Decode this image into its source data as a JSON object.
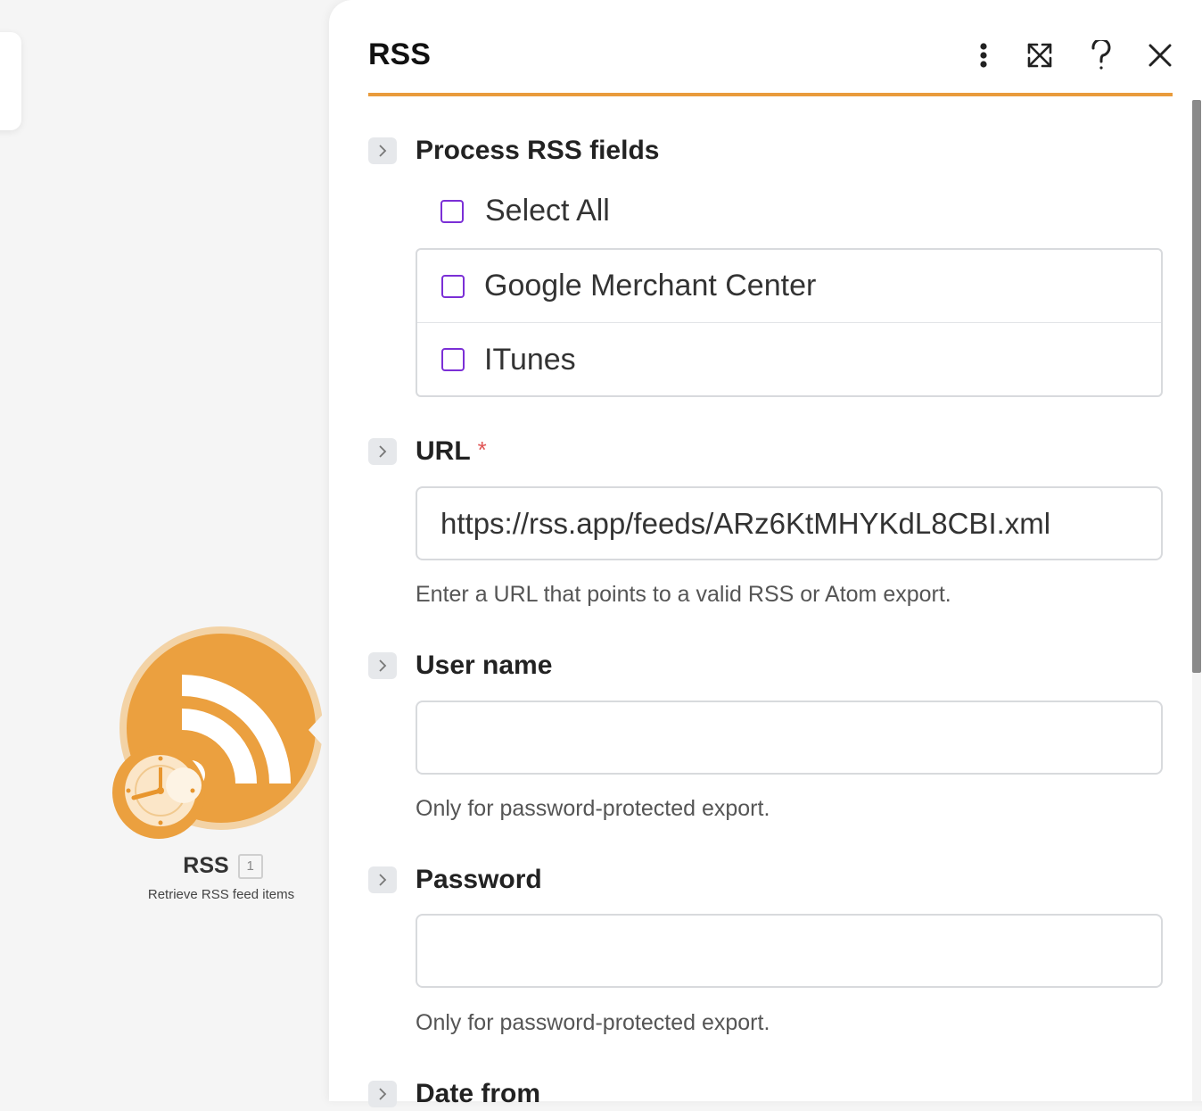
{
  "canvas": {
    "module": {
      "name": "RSS",
      "count": "1",
      "subtitle": "Retrieve RSS feed items",
      "color": "#eba03f",
      "icon": "rss-icon",
      "badge_icon": "clock-icon"
    }
  },
  "panel": {
    "title": "RSS",
    "accent_color": "#e99b3c",
    "header_buttons": [
      {
        "name": "more-options",
        "icon": "kebab-menu-icon"
      },
      {
        "name": "maximize",
        "icon": "expand-arrows-icon"
      },
      {
        "name": "help",
        "icon": "question-mark-icon"
      },
      {
        "name": "close",
        "icon": "close-icon"
      }
    ],
    "process_fields": {
      "label": "Process RSS fields",
      "select_all": "Select All",
      "options": [
        "Google Merchant Center",
        "ITunes"
      ]
    },
    "url": {
      "label": "URL",
      "required_mark": "*",
      "value": "https://rss.app/feeds/ARz6KtMHYKdL8CBI.xml",
      "hint": "Enter a URL that points to a valid RSS or Atom export."
    },
    "username": {
      "label": "User name",
      "value": "",
      "hint": "Only for password-protected export."
    },
    "password": {
      "label": "Password",
      "value": "",
      "hint": "Only for password-protected export."
    },
    "date_from": {
      "label": "Date from"
    }
  }
}
